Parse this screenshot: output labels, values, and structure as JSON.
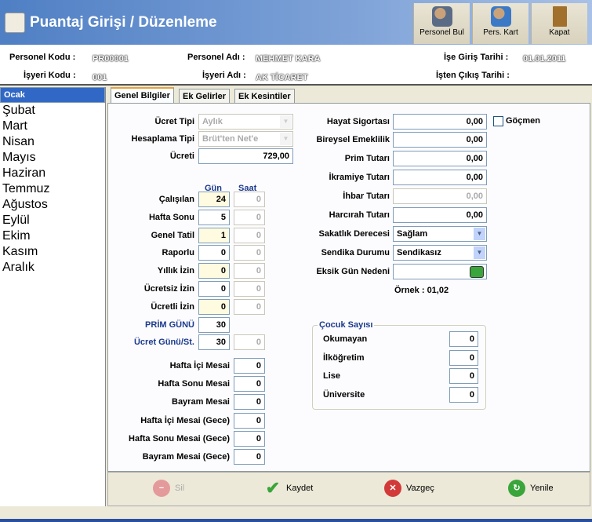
{
  "window": {
    "title": "Puantaj Girişi / Düzenleme"
  },
  "toolbar": {
    "personel_bul": "Personel Bul",
    "pers_kart": "Pers. Kart",
    "kapat": "Kapat"
  },
  "info": {
    "personel_kodu_label": "Personel Kodu :",
    "personel_kodu": "PR00001",
    "personel_adi_label": "Personel Adı :",
    "personel_adi": "MEHMET KARA",
    "ise_giris_label": "İşe Giriş Tarihi :",
    "ise_giris": "01.01.2011",
    "isyeri_kodu_label": "İşyeri Kodu :",
    "isyeri_kodu": "001",
    "isyeri_adi_label": "İşyeri Adı :",
    "isyeri_adi": "AK TİCARET",
    "isten_cikis_label": "İşten Çıkış Tarihi :",
    "isten_cikis": ""
  },
  "months": [
    "Ocak",
    "Şubat",
    "Mart",
    "Nisan",
    "Mayıs",
    "Haziran",
    "Temmuz",
    "Ağustos",
    "Eylül",
    "Ekim",
    "Kasım",
    "Aralık"
  ],
  "selected_month": "Ocak",
  "tabs": [
    "Genel Bilgiler",
    "Ek Gelirler",
    "Ek Kesintiler"
  ],
  "general": {
    "ucret_tipi_label": "Ücret Tipi",
    "ucret_tipi": "Aylık",
    "hesaplama_tipi_label": "Hesaplama Tipi",
    "hesaplama_tipi": "Brüt'ten Net'e",
    "ucreti_label": "Ücreti",
    "ucreti": "729,00",
    "gun_header": "Gün",
    "saat_header": "Saat",
    "days": [
      {
        "label": "Çalışılan",
        "gun": "24",
        "saat": "0"
      },
      {
        "label": "Hafta Sonu",
        "gun": "5",
        "saat": "0"
      },
      {
        "label": "Genel Tatil",
        "gun": "1",
        "saat": "0"
      },
      {
        "label": "Raporlu",
        "gun": "0",
        "saat": "0"
      },
      {
        "label": "Yıllık İzin",
        "gun": "0",
        "saat": "0"
      },
      {
        "label": "Ücretsiz İzin",
        "gun": "0",
        "saat": "0"
      },
      {
        "label": "Ücretli İzin",
        "gun": "0",
        "saat": "0"
      }
    ],
    "prim_gunu_label": "PRİM GÜNÜ",
    "prim_gunu": "30",
    "ucret_gunu_label": "Ücret Günü/St.",
    "ucret_gunu": "30",
    "ucret_saat": "0",
    "mesai": [
      {
        "label": "Hafta İçi Mesai",
        "value": "0"
      },
      {
        "label": "Hafta Sonu Mesai",
        "value": "0"
      },
      {
        "label": "Bayram Mesai",
        "value": "0"
      },
      {
        "label": "Hafta İçi Mesai (Gece)",
        "value": "0"
      },
      {
        "label": "Hafta Sonu Mesai (Gece)",
        "value": "0"
      },
      {
        "label": "Bayram Mesai (Gece)",
        "value": "0"
      }
    ],
    "amounts": [
      {
        "label": "Hayat Sigortası",
        "value": "0,00"
      },
      {
        "label": "Bireysel Emeklilik",
        "value": "0,00"
      },
      {
        "label": "Prim Tutarı",
        "value": "0,00"
      },
      {
        "label": "İkramiye Tutarı",
        "value": "0,00"
      },
      {
        "label": "İhbar Tutarı",
        "value": "0,00"
      },
      {
        "label": "Harcırah Tutarı",
        "value": "0,00"
      }
    ],
    "gocmen_label": "Göçmen",
    "gocmen_checked": false,
    "sakatlik_label": "Sakatlık Derecesi",
    "sakatlik": "Sağlam",
    "sendika_label": "Sendika Durumu",
    "sendika": "Sendikasız",
    "eksik_gun_label": "Eksik Gün Nedeni",
    "eksik_gun": "",
    "ornek": "Örnek : 01,02",
    "cocuk_title": "Çocuk Sayısı",
    "cocuk": [
      {
        "label": "Okumayan",
        "value": "0"
      },
      {
        "label": "İlköğretim",
        "value": "0"
      },
      {
        "label": "Lise",
        "value": "0"
      },
      {
        "label": "Üniversite",
        "value": "0"
      }
    ]
  },
  "actions": {
    "sil": "Sil",
    "kaydet": "Kaydet",
    "vazgec": "Vazgeç",
    "yenile": "Yenile"
  }
}
